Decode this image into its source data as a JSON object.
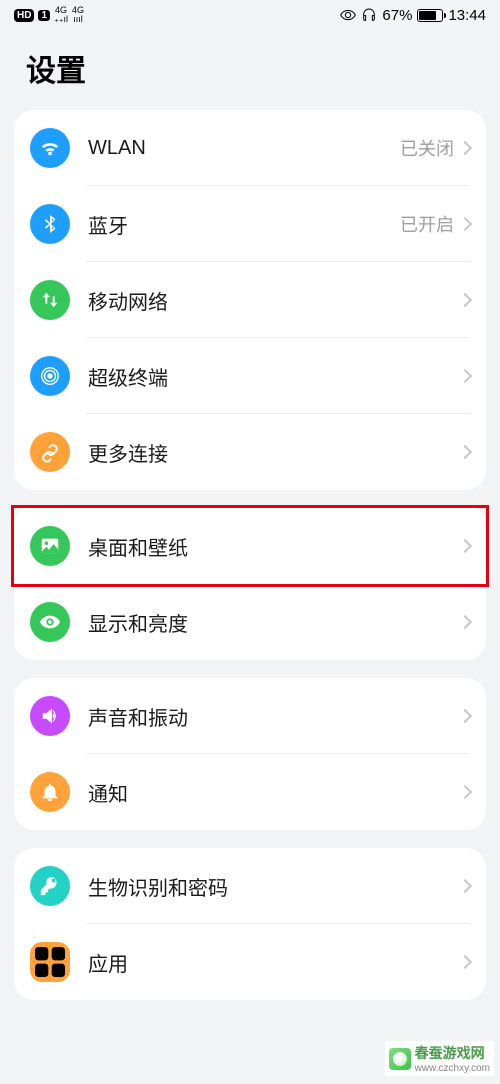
{
  "status": {
    "hd": "HD",
    "sim": "1",
    "net1": "4G",
    "net2": "4G",
    "battery_pct": "67%",
    "time": "13:44"
  },
  "page": {
    "title": "设置"
  },
  "groups": [
    {
      "rows": [
        {
          "key": "wlan",
          "label": "WLAN",
          "value": "已关闭",
          "color": "#1e9fff",
          "icon": "wifi"
        },
        {
          "key": "bluetooth",
          "label": "蓝牙",
          "value": "已开启",
          "color": "#1e9fff",
          "icon": "bluetooth"
        },
        {
          "key": "mobile",
          "label": "移动网络",
          "value": "",
          "color": "#35c75a",
          "icon": "updown"
        },
        {
          "key": "super",
          "label": "超级终端",
          "value": "",
          "color": "#1e9fff",
          "icon": "radar"
        },
        {
          "key": "more",
          "label": "更多连接",
          "value": "",
          "color": "#ffa23a",
          "icon": "link"
        }
      ]
    },
    {
      "rows": [
        {
          "key": "wallpaper",
          "label": "桌面和壁纸",
          "value": "",
          "color": "#35c75a",
          "icon": "image",
          "highlighted": true
        },
        {
          "key": "display",
          "label": "显示和亮度",
          "value": "",
          "color": "#35c75a",
          "icon": "eye"
        }
      ]
    },
    {
      "rows": [
        {
          "key": "sound",
          "label": "声音和振动",
          "value": "",
          "color": "#c64bff",
          "icon": "volume"
        },
        {
          "key": "notify",
          "label": "通知",
          "value": "",
          "color": "#ffa23a",
          "icon": "bell"
        }
      ]
    },
    {
      "rows": [
        {
          "key": "biometric",
          "label": "生物识别和密码",
          "value": "",
          "color": "#22d3c5",
          "icon": "key"
        },
        {
          "key": "apps",
          "label": "应用",
          "value": "",
          "color": "#ffa23a",
          "icon": "grid",
          "rounded": true
        }
      ]
    }
  ],
  "watermark": {
    "name": "春蚕游戏网",
    "url": "www.czchxy.com"
  }
}
